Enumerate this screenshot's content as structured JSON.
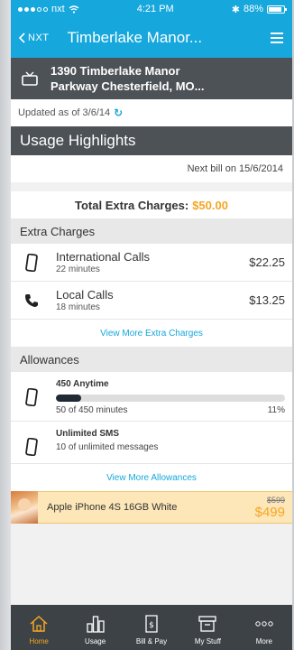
{
  "status_bar": {
    "carrier": "nxt",
    "time": "4:21 PM",
    "battery": "88%",
    "battery_level": 0.88
  },
  "nav": {
    "back_label": "NXT",
    "title": "Timberlake Manor..."
  },
  "account": {
    "address_line1": "1390 Timberlake Manor",
    "address_line2": "Parkway Chesterfield, MO..."
  },
  "updated": {
    "text": "Updated as of 3/6/14"
  },
  "usage": {
    "heading": "Usage Highlights",
    "next_bill": "Next bill on 15/6/2014",
    "total_label": "Total Extra Charges:",
    "total_amount": "$50.00"
  },
  "extra_charges": {
    "heading": "Extra Charges",
    "items": [
      {
        "name": "International Calls",
        "detail": "22 minutes",
        "price": "$22.25",
        "icon": "mobile-phone-icon"
      },
      {
        "name": "Local Calls",
        "detail": "18 minutes",
        "price": "$13.25",
        "icon": "phone-handset-icon"
      }
    ],
    "view_more": "View More Extra Charges"
  },
  "allowances": {
    "heading": "Allowances",
    "items": [
      {
        "title": "450 Anytime",
        "detail": "50 of 450 minutes",
        "percent": "11%",
        "fraction": 0.11
      },
      {
        "title": "Unlimited SMS",
        "detail": "10 of unlimited messages"
      }
    ],
    "view_more": "View More Allowances"
  },
  "promo": {
    "name": "Apple iPhone 4S 16GB White",
    "old_price": "$599",
    "new_price": "$499"
  },
  "tabs": [
    {
      "label": "Home",
      "icon": "home-icon",
      "active": true
    },
    {
      "label": "Usage",
      "icon": "usage-chart-icon"
    },
    {
      "label": "Bill & Pay",
      "icon": "bill-icon"
    },
    {
      "label": "My Stuff",
      "icon": "box-icon"
    },
    {
      "label": "More",
      "icon": "more-dots-icon"
    }
  ],
  "colors": {
    "accent": "#16a7dc",
    "highlight": "#f5a623",
    "header": "#4d5257",
    "tabbar": "#3d4247"
  }
}
